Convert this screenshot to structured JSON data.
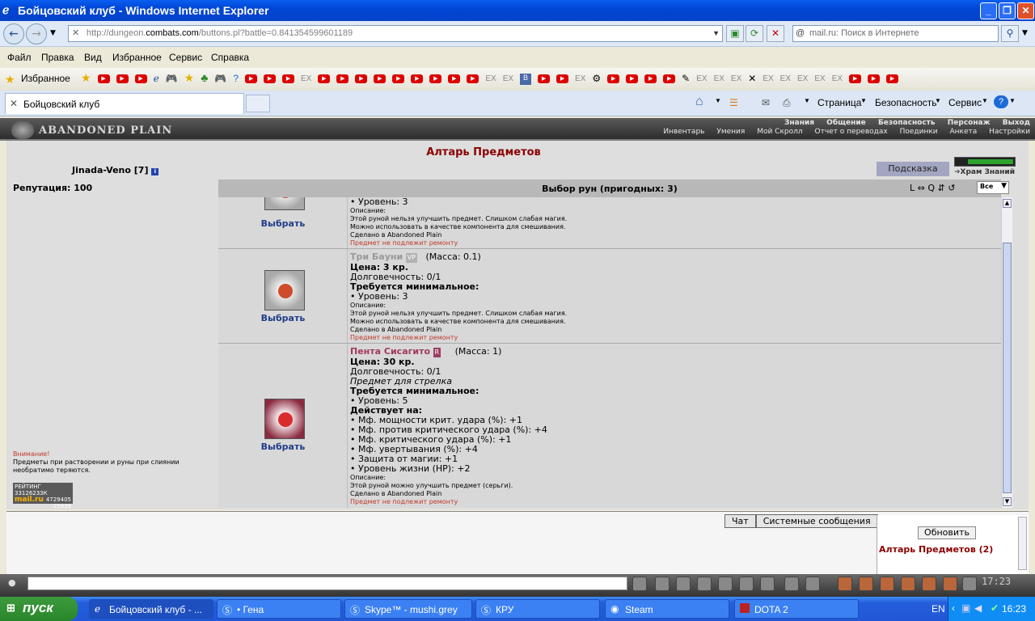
{
  "window": {
    "title": "Бойцовский клуб - Windows Internet Explorer"
  },
  "address": {
    "url_prefix": "http://dungeon.",
    "url_host": "combats.com",
    "url_rest": "/buttons.pl?battle=0.841354599601189",
    "search_placeholder": "mail.ru: Поиск в Интернете"
  },
  "menu": [
    "Файл",
    "Правка",
    "Вид",
    "Избранное",
    "Сервис",
    "Справка"
  ],
  "favbar": {
    "favorites_label": "Избранное",
    "ex": "EX"
  },
  "tab": {
    "label": "Бойцовский клуб"
  },
  "cmdbar": {
    "page": "Страница",
    "security": "Безопасность",
    "service": "Сервис"
  },
  "game": {
    "logo": "ABANDONED PLAIN",
    "nav_top": [
      "Знания",
      "Общение",
      "Безопасность",
      "Персонаж",
      "Выход"
    ],
    "nav_bottom": [
      "Инвентарь",
      "Умения",
      "Мой Скролл",
      "Отчет о переводах",
      "Поединки",
      "Анкета",
      "Настройки"
    ],
    "page_title": "Алтарь Предметов",
    "player": "Jinada-Veno [7]",
    "reputation": "Репутация: 100",
    "hint": "Подсказка",
    "hram": "Храм Знаний",
    "table_title": "Выбор рун (пригодных: 3)",
    "table_tools": "L  ⇔ Q  ⇵ ↺",
    "filter": "Все",
    "pick_label": "Выбрать",
    "item1": {
      "level": "• Уровень: 3",
      "desc_label": "Описание:",
      "desc1": "Этой руной нельзя улучшить предмет. Слишком слабая магия.",
      "desc2": "Можно использовать в качестве компонента для смешивания.",
      "made": "Сделано в Abandoned Plain",
      "norepair": "Предмет не подлежит ремонту"
    },
    "item2": {
      "name": "Три Бауни",
      "badge": "VP",
      "mass": "(Масса: 0.1)",
      "price": "Цена: 3 кр.",
      "dur": "Долговечность: 0/1",
      "req": "Требуется минимальное:",
      "level": "• Уровень: 3",
      "desc_label": "Описание:",
      "desc1": "Этой руной нельзя улучшить предмет. Слишком слабая магия.",
      "desc2": "Можно использовать в качестве компонента для смешивания.",
      "made": "Сделано в Abandoned Plain",
      "norepair": "Предмет не подлежит ремонту"
    },
    "item3": {
      "name": "Пента Сисагито",
      "badge": "R",
      "mass": "(Масса: 1)",
      "price": "Цена: 30 кр.",
      "dur": "Долговечность: 0/1",
      "for": "Предмет для стрелка",
      "req": "Требуется минимальное:",
      "level": "• Уровень: 5",
      "acts": "Действует на:",
      "m1": "• Мф. мощности крит. удара (%): +1",
      "m2": "• Мф. против критического удара (%): +4",
      "m3": "• Мф. критического удара (%): +1",
      "m4": "• Мф. увертывания (%): +4",
      "m5": "• Защита от магии: +1",
      "m6": "• Уровень жизни (HP): +2",
      "desc_label": "Описание:",
      "desc1": "Этой руной можно улучшить предмет (серьги).",
      "made": "Сделано в Abandoned Plain",
      "norepair": "Предмет не подлежит ремонту"
    },
    "warn_title": "Внимание!",
    "warn_text": "Предметы при растворении и руны при слиянии необратимо теряются.",
    "rating": {
      "label": "РЕЙТИНГ 33126233К",
      "brand": "mail.ru",
      "n1": "4729405",
      "n2": "15939"
    }
  },
  "chat": {
    "tab1": "Чат",
    "tab2": "Системные сообщения",
    "refresh": "Обновить",
    "altar": "Алтарь Предметов (2)",
    "clock": "17:23"
  },
  "taskbar": {
    "start": "пуск",
    "tasks": [
      "Бойцовский клуб - ...",
      "• Гена",
      "Skype™ - mushi.grey",
      "КРУ",
      "Steam",
      "DOTA 2"
    ],
    "lang": "EN",
    "time": "16:23"
  }
}
